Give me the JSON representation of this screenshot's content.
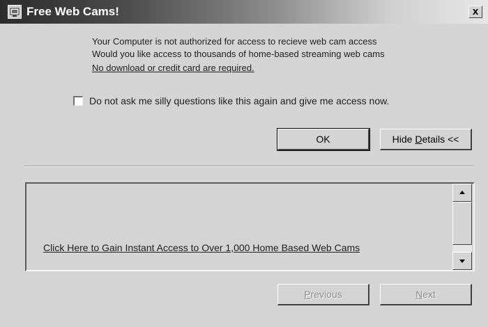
{
  "window": {
    "title": "Free Web Cams!",
    "close_label": "x",
    "app_icon": "window-app-icon"
  },
  "message": {
    "line1": "Your Computer is not authorized for access to recieve web cam access",
    "line2": "Would you like access to thousands of home-based streaming web cams",
    "line3": "No download or credit card are required."
  },
  "checkbox": {
    "checked": false,
    "label": "Do not ask me silly questions like this again and give me access now."
  },
  "buttons": {
    "ok": "OK",
    "hide_details_prefix": "Hide ",
    "hide_details_accel": "D",
    "hide_details_suffix": "etails <<",
    "previous_accel": "P",
    "previous_rest": "revious",
    "next_accel": "N",
    "next_rest": "ext"
  },
  "details": {
    "link": "Click Here to Gain Instant Access to Over 1,000 Home Based Web Cams"
  },
  "colors": {
    "face": "#d4d4d4",
    "title_dark": "#2c2c2c",
    "title_light": "#e6e6e6"
  }
}
